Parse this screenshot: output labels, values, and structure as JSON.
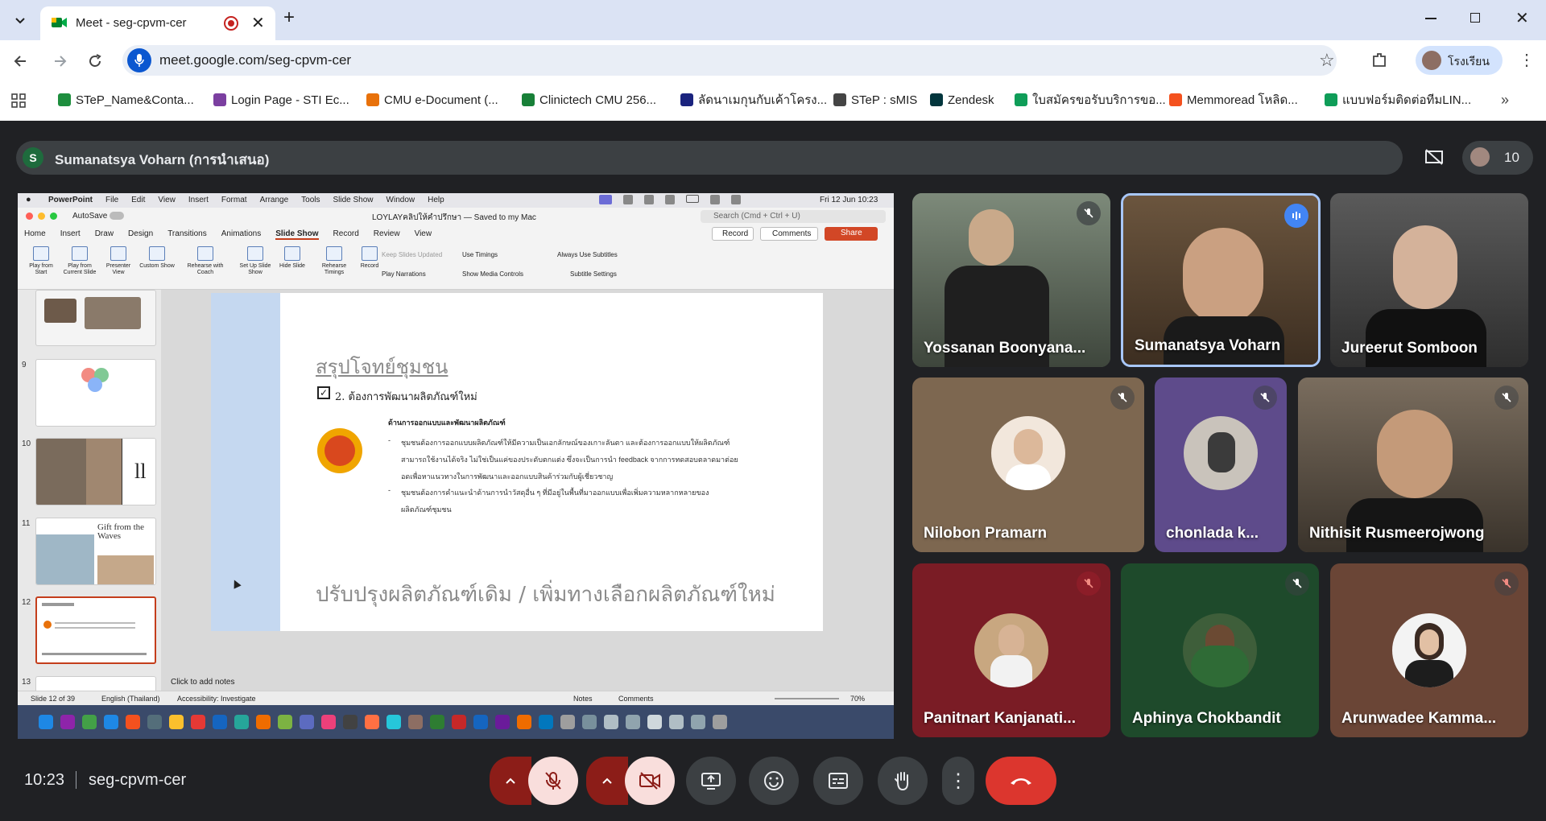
{
  "browser": {
    "tab_title": "Meet - seg-cpvm-cer",
    "url": "meet.google.com/seg-cpvm-cer",
    "profile_name": "โรงเรียน",
    "bookmarks": [
      {
        "label": "STeP_Name&Conta...",
        "color": "#1e8e3e"
      },
      {
        "label": "Login Page - STI Ec...",
        "color": "#7b3fa0"
      },
      {
        "label": "CMU e-Document (...",
        "color": "#e8710a"
      },
      {
        "label": "Clinictech CMU 256...",
        "color": "#188038"
      },
      {
        "label": "ลัดนาเมกุนกับเค้าโครง...",
        "color": "#1a237e"
      },
      {
        "label": "STeP : sMIS",
        "color": "#444444"
      },
      {
        "label": "Zendesk",
        "color": "#03363d"
      },
      {
        "label": "ใบสมัครขอรับบริการขอ...",
        "color": "#0f9d58"
      },
      {
        "label": "Memmoread โหลิด...",
        "color": "#f4511e"
      },
      {
        "label": "แบบฟอร์มติดต่อทีมLIN...",
        "color": "#0f9d58"
      }
    ]
  },
  "meet": {
    "presenter_initial": "S",
    "presenter_label": "Sumanatsya Voharn (การนำเสนอ)",
    "participant_count": "10",
    "time": "10:23",
    "meeting_code": "seg-cpvm-cer",
    "participants": [
      {
        "name": "Yossanan Boonyana...",
        "muted": true
      },
      {
        "name": "Sumanatsya Voharn",
        "muted": false,
        "speaking": true
      },
      {
        "name": "Jureerut Somboon",
        "muted": false
      },
      {
        "name": "Nilobon Pramarn",
        "muted": true
      },
      {
        "name": "chonlada k...",
        "muted": true
      },
      {
        "name": "Nithisit Rusmeerojwong",
        "muted": true
      },
      {
        "name": "Panitnart Kanjanati...",
        "muted": true
      },
      {
        "name": "Aphinya Chokbandit",
        "muted": true
      },
      {
        "name": "Arunwadee Kamma...",
        "muted": true
      }
    ]
  },
  "powerpoint": {
    "mac_menu": [
      "PowerPoint",
      "File",
      "Edit",
      "View",
      "Insert",
      "Format",
      "Arrange",
      "Tools",
      "Slide Show",
      "Window",
      "Help"
    ],
    "mac_clock": "Fri 12 Jun  10:23",
    "autosave": "AutoSave",
    "doc_title": "LOYLAYคลิปให้คำปรึกษา — Saved to my Mac",
    "search_placeholder": "Search (Cmd + Ctrl + U)",
    "ribbon_tabs": [
      "Home",
      "Insert",
      "Draw",
      "Design",
      "Transitions",
      "Animations",
      "Slide Show",
      "Record",
      "Review",
      "View"
    ],
    "record_btn": "Record",
    "comments_btn": "Comments",
    "share_btn": "Share",
    "ribbon_items": [
      "Play from Start",
      "Play from Current Slide",
      "Presenter View",
      "Custom Show",
      "Rehearse with Coach",
      "Set Up Slide Show",
      "Hide Slide",
      "Rehearse Timings",
      "Record"
    ],
    "keep_slides": "Keep Slides Updated",
    "use_timings": "Use Timings",
    "always_subtitles": "Always Use Subtitles",
    "play_narrations": "Play Narrations",
    "show_media": "Show Media Controls",
    "subtitle_settings": "Subtitle Settings",
    "thumb_numbers": [
      "9",
      "10",
      "11",
      "12",
      "13"
    ],
    "slide": {
      "title": "สรุปโจทย์ชุมชน",
      "subtitle": "2. ต้องการพัฒนาผลิตภัณฑ์ใหม่",
      "section_head": "ด้านการออกแบบและพัฒนาผลิตภัณฑ์",
      "bullet1": "ชุมชนต้องการออกแบบผลิตภัณฑ์ให้มีความเป็นเอกลักษณ์ของเกาะลันตา และต้องการออกแบบให้ผลิตภัณฑ์สามารถใช้งานได้จริง ไม่ใช่เป็นแค่ของประดับตกแต่ง ซึ่งจะเป็นการนำ feedback จากการทดสอบตลาดมาต่อยอดเพื่อหาแนวทางในการพัฒนาและออกแบบสินค้าร่วมกับผู้เชี่ยวชาญ",
      "bullet2": "ชุมชนต้องการคำแนะนำด้านการนำวัสดุอื่น ๆ ที่มีอยู่ในพื้นที่มาออกแบบเพื่อเพิ่มความหลากหลายของผลิตภัณฑ์ชุมชน",
      "bottom_text": "ปรับปรุงผลิตภัณฑ์เดิม / เพิ่มทางเลือกผลิตภัณฑ์ใหม่"
    },
    "notes_placeholder": "Click to add notes",
    "status_slide": "Slide 12 of 39",
    "status_lang": "English (Thailand)",
    "status_access": "Accessibility: Investigate",
    "status_notes": "Notes",
    "status_comments": "Comments",
    "zoom": "70%",
    "thumb11_text": "Gift from the Waves"
  }
}
